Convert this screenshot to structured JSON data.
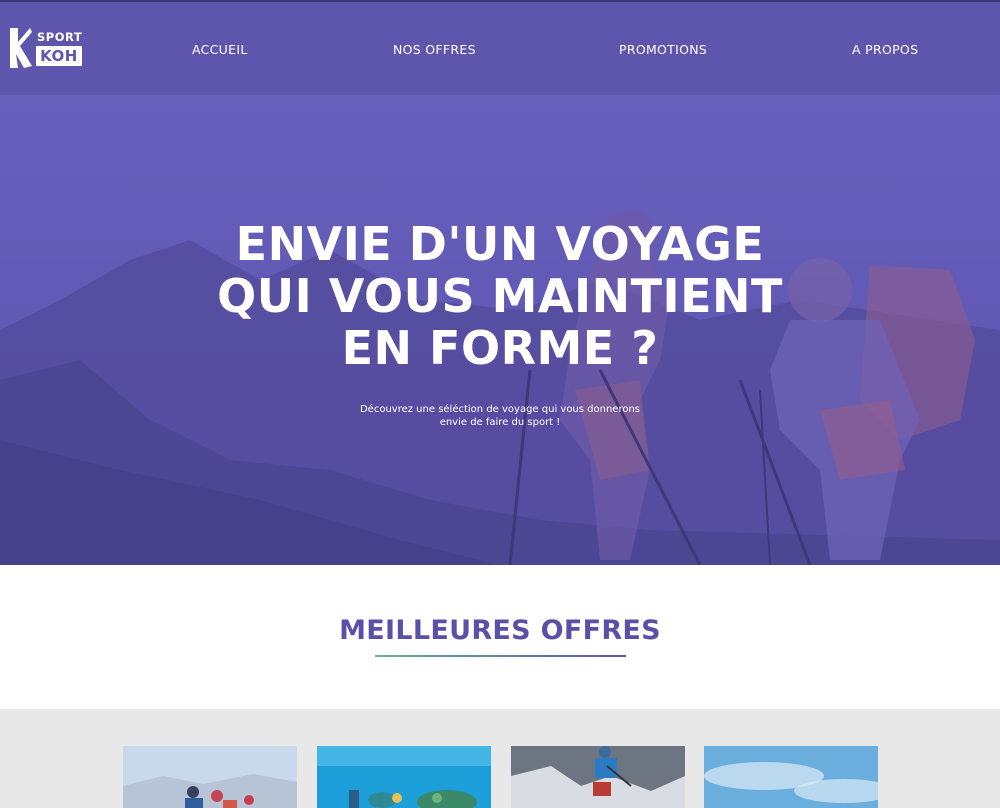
{
  "header": {
    "logo_top": "SPORT",
    "logo_bottom": "KOH",
    "nav": [
      {
        "label": "ACCUEIL"
      },
      {
        "label": "NOS OFFRES"
      },
      {
        "label": "PROMOTIONS"
      },
      {
        "label": "A PROPOS"
      }
    ]
  },
  "hero": {
    "title_line1": "ENVIE D'UN VOYAGE",
    "title_line2": "QUI VOUS MAINTIENT",
    "title_line3": "EN FORME ?",
    "subtitle_line1": "Découvrez une séléction de voyage qui vous donnerons",
    "subtitle_line2": "envie de faire du sport !"
  },
  "offers": {
    "title": "MEILLEURES OFFRES",
    "cards": [
      {
        "image": "hiking-photo"
      },
      {
        "image": "diving-photo"
      },
      {
        "image": "skiing-photo"
      },
      {
        "image": "sky-photo"
      }
    ]
  },
  "colors": {
    "primary": "#5e55ad",
    "title": "#5a50a8",
    "band": "#e8e8e8",
    "accent_line": "#6ab09a"
  }
}
